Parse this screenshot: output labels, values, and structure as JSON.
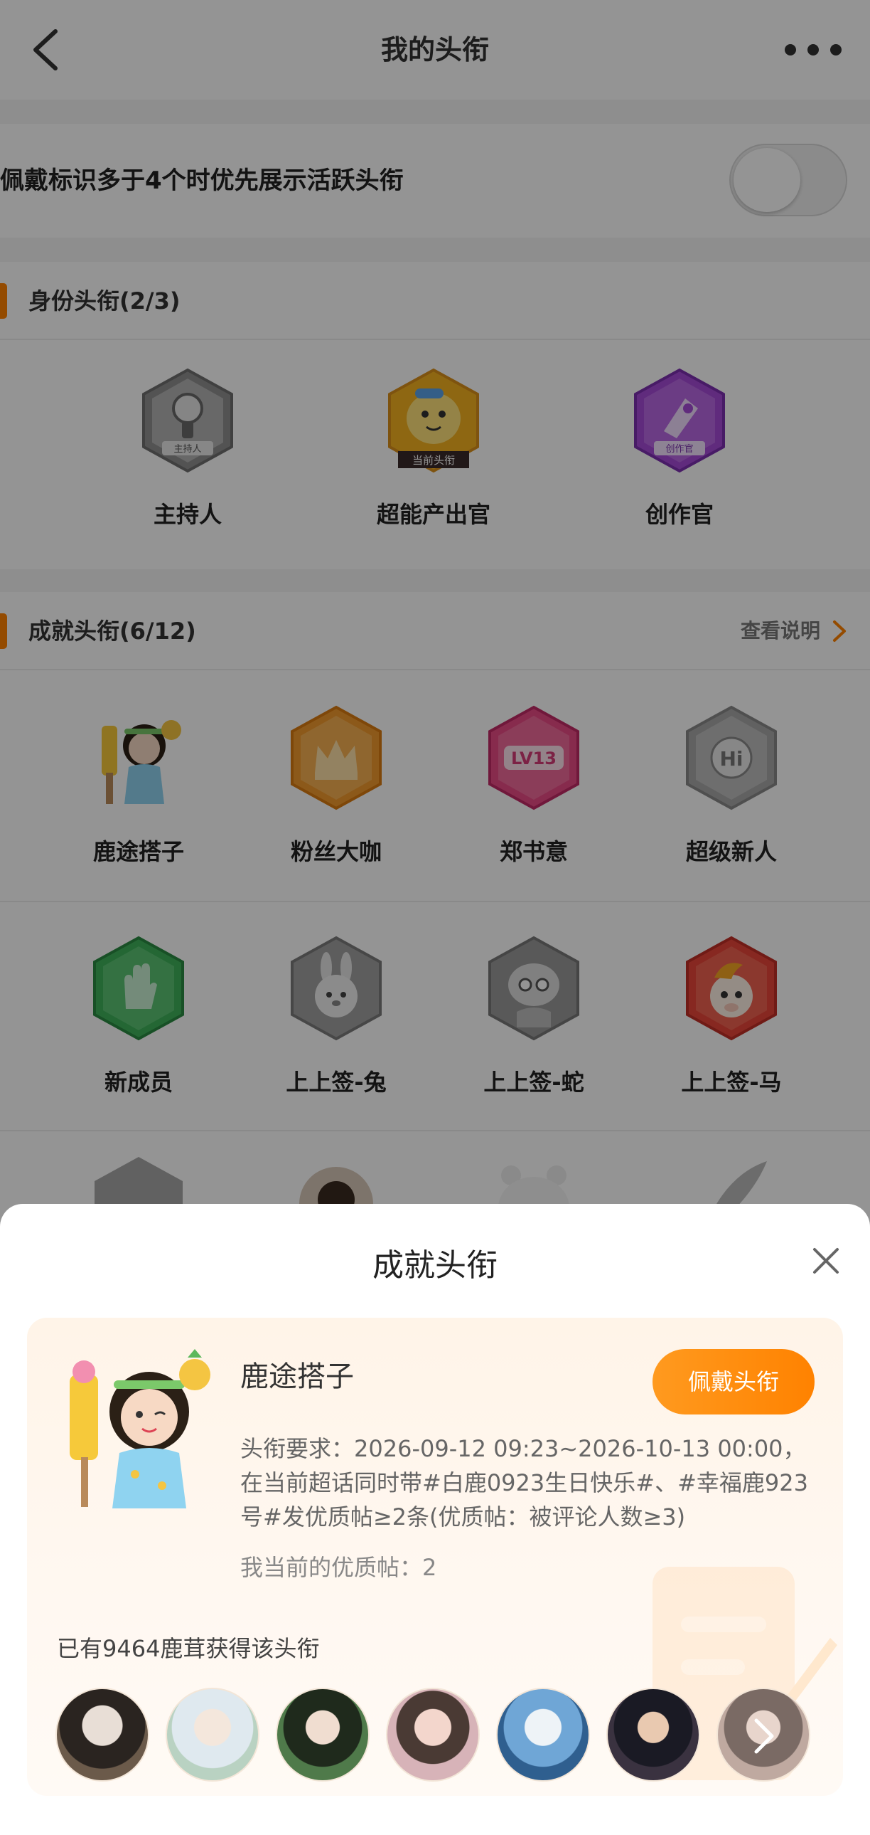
{
  "colors": {
    "accent": "#ff8200",
    "title_text": "#333333",
    "dim_overlay": "rgba(0,0,0,0.42)"
  },
  "nav": {
    "back_icon": "chevron-left-icon",
    "title": "我的头衔",
    "more_icon": "more-icon"
  },
  "settings": {
    "toggle_label": "佩戴标识多于4个时优先展示活跃头衔",
    "toggle_on": false
  },
  "identity_section": {
    "title": "身份头衔(2/3)",
    "badges": [
      {
        "name": "主持人",
        "badge_text": "主持人",
        "color": "#9b9b9b"
      },
      {
        "name": "超能产出官",
        "badge_text": "当前头衔",
        "color": "#f5b120"
      },
      {
        "name": "创作官",
        "badge_text": "创作官",
        "color": "#a64bd8"
      }
    ]
  },
  "achievement_section": {
    "title": "成就头衔(6/12)",
    "link": "查看说明",
    "rows": [
      [
        {
          "name": "鹿途搭子",
          "kind": "avatar"
        },
        {
          "name": "粉丝大咖",
          "color": "#f29a2e"
        },
        {
          "name": "郑书意",
          "badge_text": "LV13",
          "color": "#e84b86"
        },
        {
          "name": "超级新人",
          "badge_text": "Hi",
          "color": "#a8a8a8"
        }
      ],
      [
        {
          "name": "新成员",
          "color": "#3fb25b"
        },
        {
          "name": "上上签-兔",
          "color": "#a0a0a0"
        },
        {
          "name": "上上签-蛇",
          "color": "#9a9a9a"
        },
        {
          "name": "上上签-马",
          "color": "#e8463a"
        }
      ]
    ]
  },
  "sheet": {
    "title": "成就头衔",
    "close_icon": "close-icon",
    "card": {
      "name": "鹿途搭子",
      "wear_button": "佩戴头衔",
      "requirement_lines": [
        "头衔要求：2026-09-12 09:23~2026-10-13 00:00，",
        "在当前超话同时带#白鹿0923生日快乐#、#幸福鹿923",
        "号#发优质帖≥2条(优质帖：被评论人数≥3)"
      ],
      "my_posts": "我当前的优质帖：2",
      "owners_text": "已有9464鹿茸获得该头衔",
      "owner_avatars": [
        "avatar-1",
        "avatar-2",
        "avatar-3",
        "avatar-4",
        "avatar-5",
        "avatar-6",
        "avatar-7"
      ]
    }
  }
}
